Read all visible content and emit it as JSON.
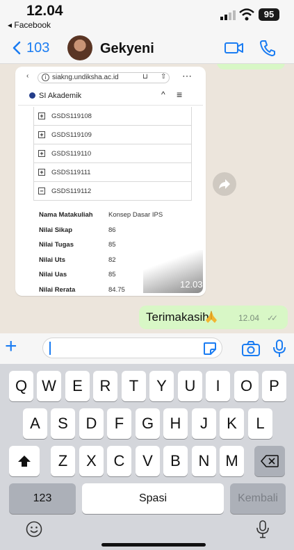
{
  "status_bar": {
    "time": "12.04",
    "back_app": "◂ Facebook",
    "battery": "95"
  },
  "header": {
    "back_count": "103",
    "contact_name": "Gekyeni"
  },
  "shared_screenshot": {
    "url": "siakng.undiksha.ac.id",
    "site_name": "SI Akademik",
    "tree_items": [
      {
        "code": "GSDS119108",
        "toggle": "+"
      },
      {
        "code": "GSDS119109",
        "toggle": "+"
      },
      {
        "code": "GSDS119110",
        "toggle": "+"
      },
      {
        "code": "GSDS119111",
        "toggle": "+"
      },
      {
        "code": "GSDS119112",
        "toggle": "−"
      }
    ],
    "details": [
      {
        "label": "Nama Matakuliah",
        "value": "Konsep Dasar IPS"
      },
      {
        "label": "Nilai Sikap",
        "value": "86"
      },
      {
        "label": "Nilai Tugas",
        "value": "85"
      },
      {
        "label": "Nilai Uts",
        "value": "82"
      },
      {
        "label": "Nilai Uas",
        "value": "85"
      },
      {
        "label": "Nilai Rerata",
        "value": "84.75"
      }
    ],
    "time": "12.03"
  },
  "outgoing_message": {
    "text": "Terimakasih",
    "time": "12.04"
  },
  "input_bar": {
    "placeholder": ""
  },
  "keyboard": {
    "row1": [
      "Q",
      "W",
      "E",
      "R",
      "T",
      "Y",
      "U",
      "I",
      "O",
      "P"
    ],
    "row2": [
      "A",
      "S",
      "D",
      "F",
      "G",
      "H",
      "J",
      "K",
      "L"
    ],
    "row3": [
      "Z",
      "X",
      "C",
      "V",
      "B",
      "N",
      "M"
    ],
    "numbers_label": "123",
    "space_label": "Spasi",
    "return_label": "Kembali"
  },
  "colors": {
    "accent": "#1a7cf2",
    "outgoing_bubble": "#d8f7c6",
    "chat_bg": "#ece5dc",
    "keyboard_bg": "#d4d6db"
  }
}
